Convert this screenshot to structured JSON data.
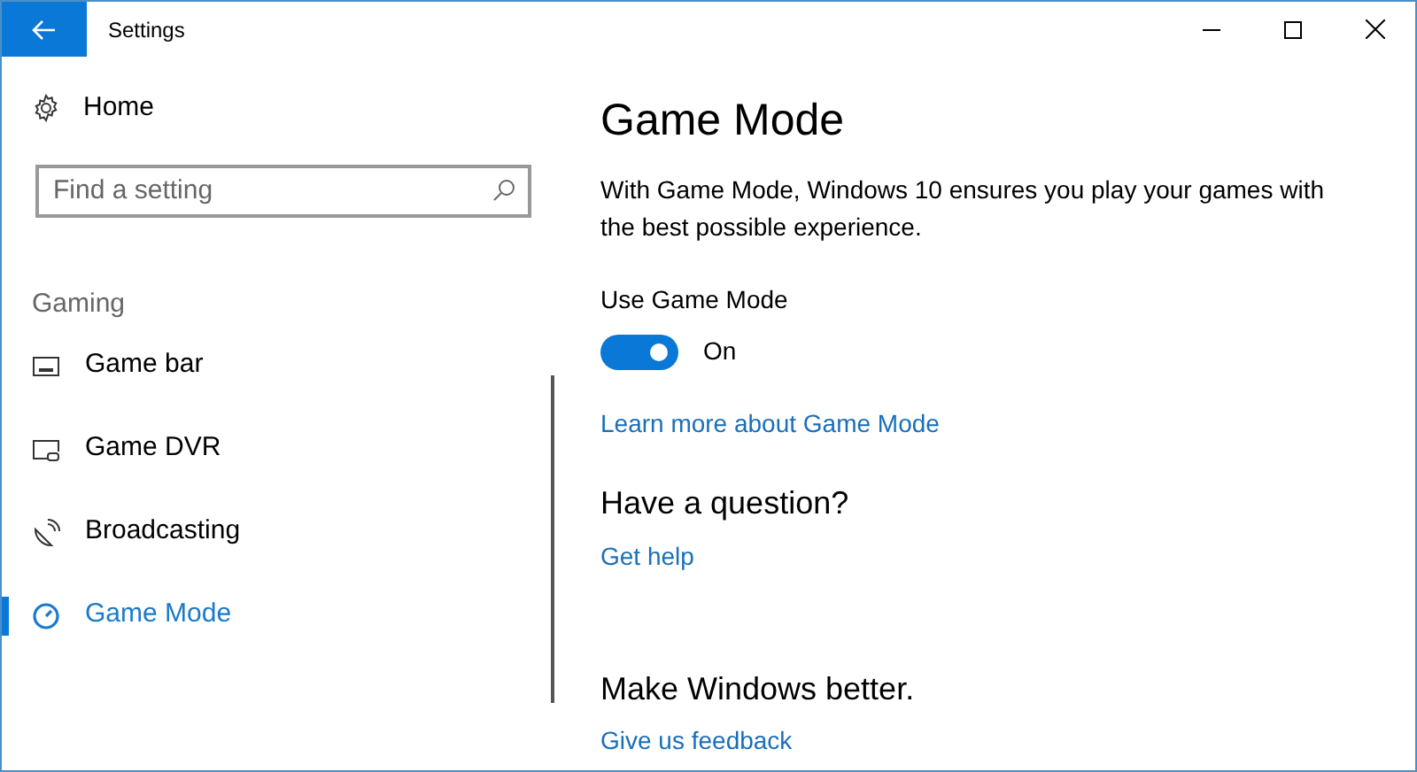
{
  "window": {
    "title": "Settings"
  },
  "sidebar": {
    "home": "Home",
    "search": {
      "placeholder": "Find a setting"
    },
    "section": "Gaming",
    "items": [
      {
        "label": "Game bar",
        "kind": "gamebar",
        "selected": false
      },
      {
        "label": "Game DVR",
        "kind": "dvr",
        "selected": false
      },
      {
        "label": "Broadcasting",
        "kind": "broadcast",
        "selected": false
      },
      {
        "label": "Game Mode",
        "kind": "gamemode",
        "selected": true
      }
    ]
  },
  "content": {
    "title": "Game Mode",
    "description": "With Game Mode, Windows 10 ensures you play your games with the best possible experience.",
    "toggle": {
      "label": "Use Game Mode",
      "on": true,
      "state_text": "On"
    },
    "link": "Learn more about Game Mode",
    "sections": [
      {
        "heading": "Have a question?",
        "link": "Get help"
      },
      {
        "heading": "Make Windows better.",
        "link": "Give us feedback"
      }
    ]
  }
}
